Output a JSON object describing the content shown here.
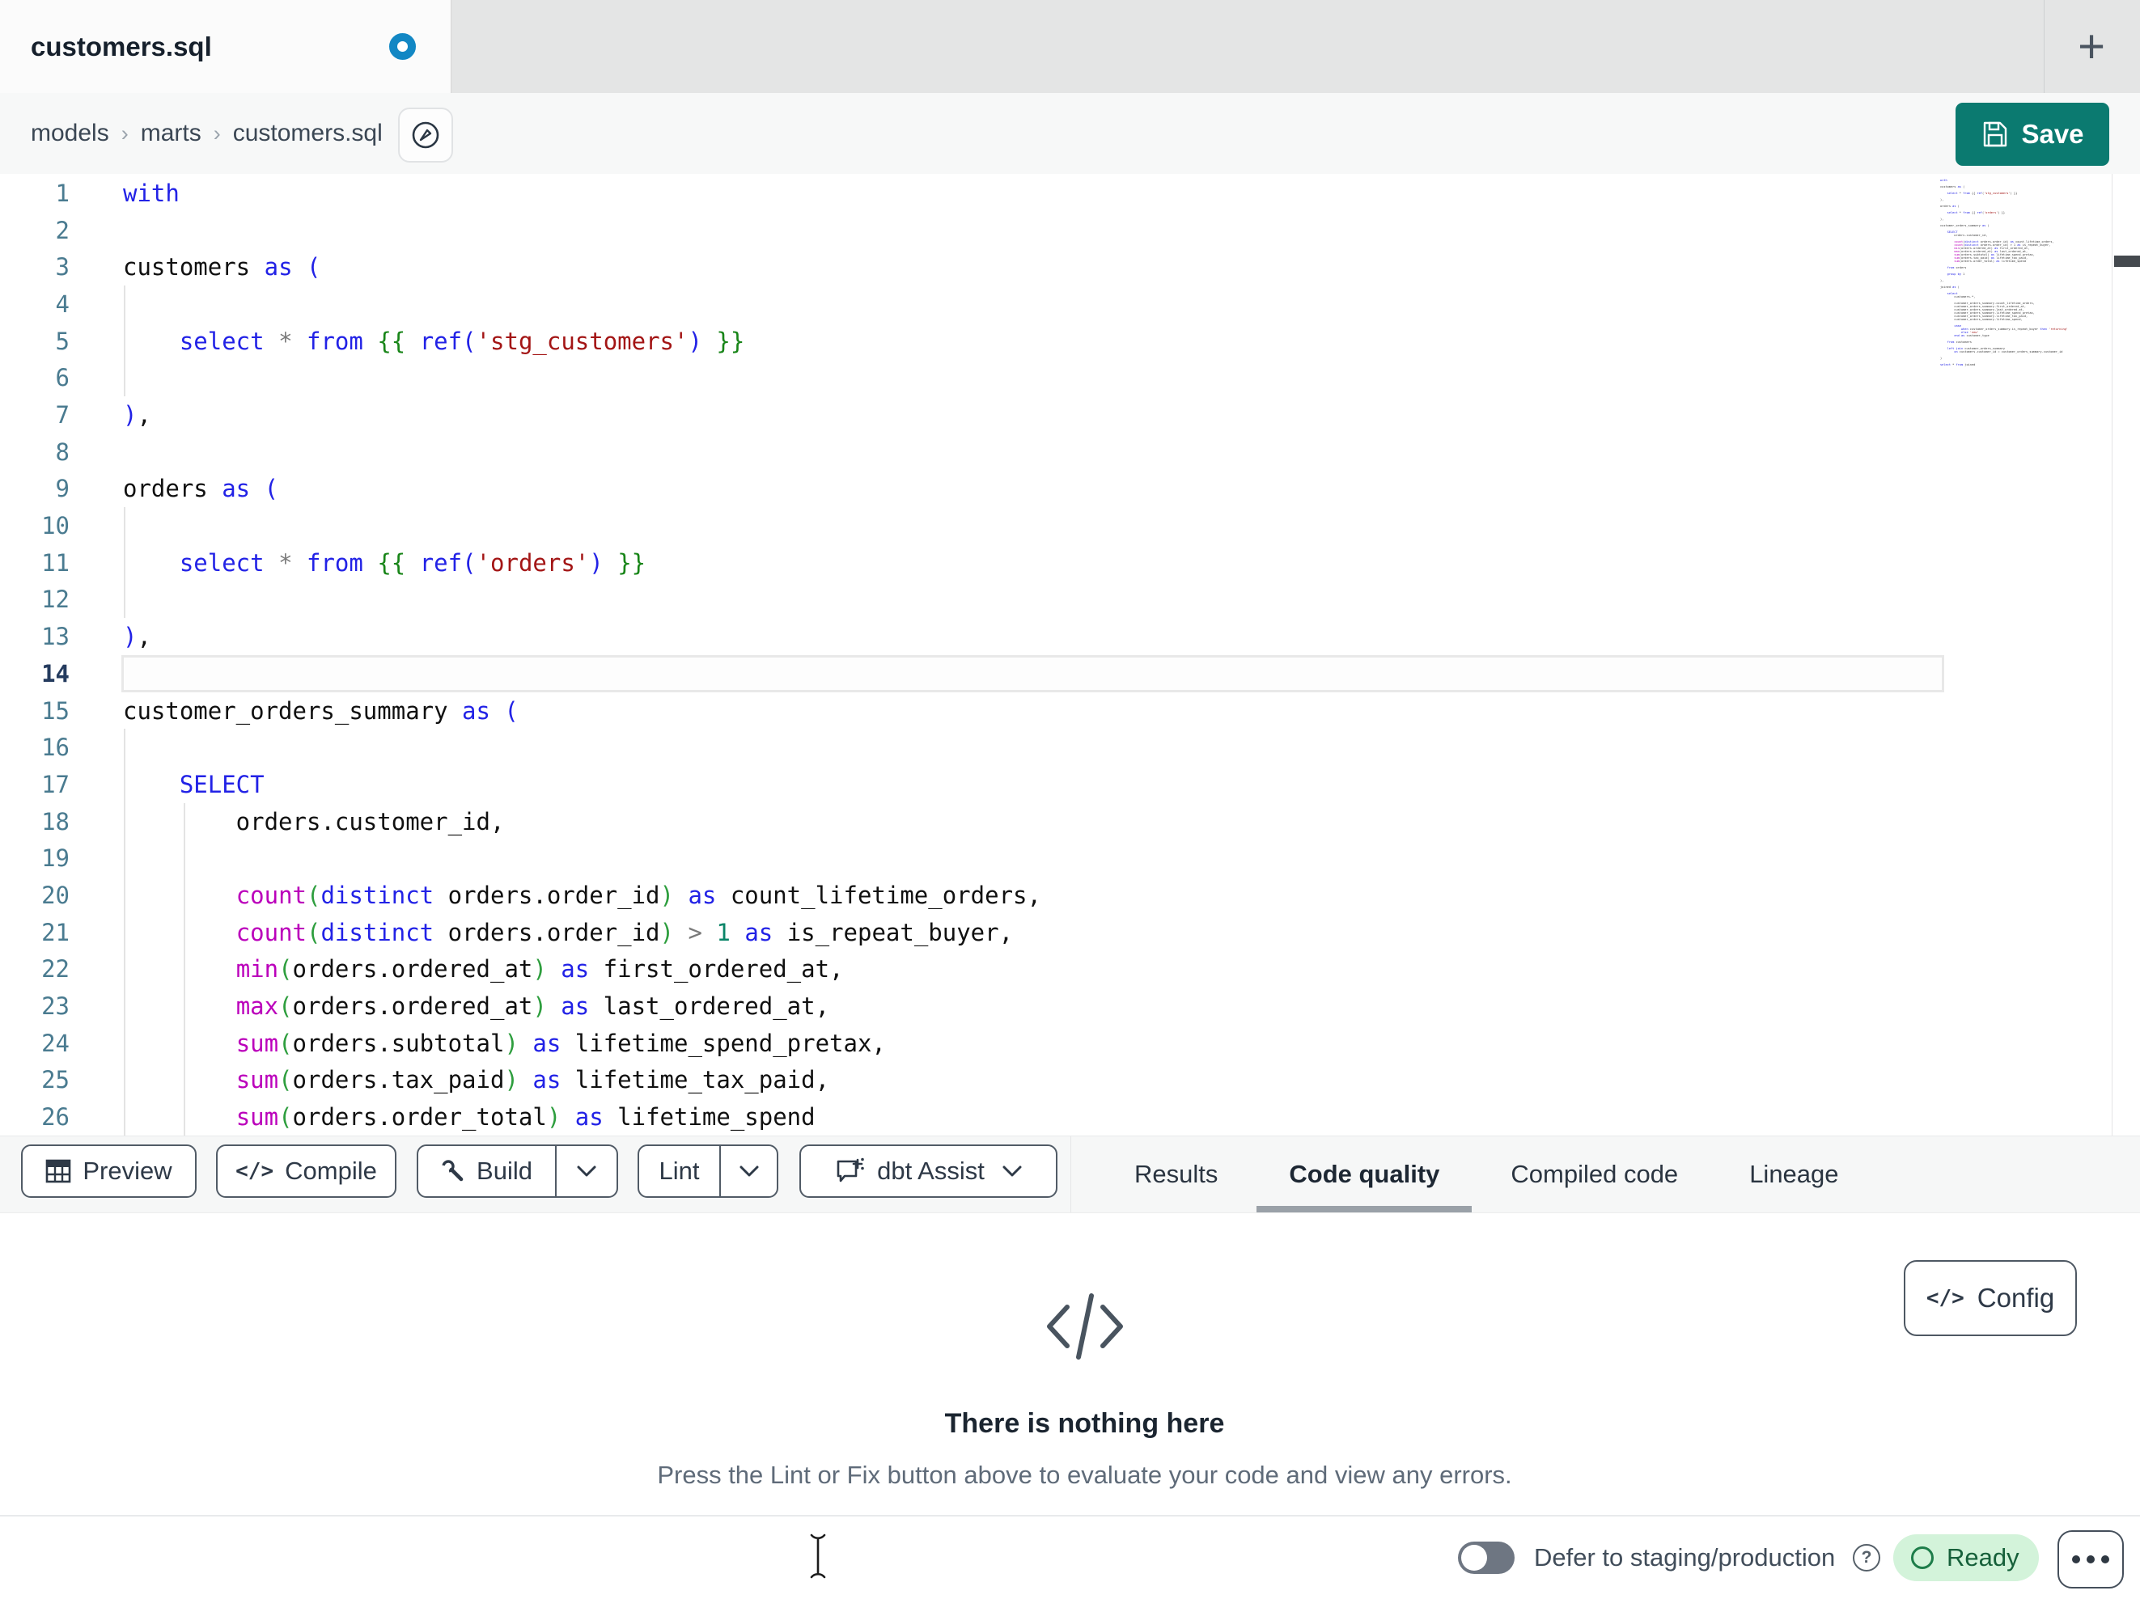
{
  "colors": {
    "accent_teal": "#0B7A70",
    "unsaved_dot_blue": "#1287C4",
    "keyword_blue": "#2222E6",
    "function_magenta": "#BB00BB",
    "string_red": "#A31515",
    "jinja_green": "#188518",
    "number_green": "#0A8568",
    "gutter_teal": "#4A7B90",
    "active_gutter_navy": "#243B5E",
    "ready_bg_green": "#D3F3DA",
    "ready_text_green": "#16603A",
    "tab_underline_gray": "#9AA1A8"
  },
  "tabbar": {
    "title": "customers.sql",
    "new_tab": "+"
  },
  "breadcrumb": {
    "items": [
      "models",
      "marts",
      "customers.sql"
    ],
    "separator": "›"
  },
  "save_label": "Save",
  "editor": {
    "active_line": 14,
    "lines": [
      {
        "tokens": [
          [
            "k",
            "with"
          ]
        ]
      },
      {
        "tokens": []
      },
      {
        "tokens": [
          [
            "v",
            "customers "
          ],
          [
            "k",
            "as"
          ],
          [
            "v",
            " "
          ],
          [
            "bb",
            "("
          ]
        ]
      },
      {
        "tokens": []
      },
      {
        "tokens": [
          [
            "v",
            "    "
          ],
          [
            "k",
            "select"
          ],
          [
            "v",
            " "
          ],
          [
            "o",
            "*"
          ],
          [
            "v",
            " "
          ],
          [
            "k",
            "from"
          ],
          [
            "v",
            " "
          ],
          [
            "j",
            "{{ "
          ],
          [
            "k",
            "ref"
          ],
          [
            "bb",
            "("
          ],
          [
            "s",
            "'stg_customers'"
          ],
          [
            "bb",
            ")"
          ],
          [
            "j",
            " }}"
          ]
        ]
      },
      {
        "tokens": []
      },
      {
        "tokens": [
          [
            "bb",
            ")"
          ],
          [
            "v",
            ","
          ]
        ]
      },
      {
        "tokens": []
      },
      {
        "tokens": [
          [
            "v",
            "orders "
          ],
          [
            "k",
            "as"
          ],
          [
            "v",
            " "
          ],
          [
            "bb",
            "("
          ]
        ]
      },
      {
        "tokens": []
      },
      {
        "tokens": [
          [
            "v",
            "    "
          ],
          [
            "k",
            "select"
          ],
          [
            "v",
            " "
          ],
          [
            "o",
            "*"
          ],
          [
            "v",
            " "
          ],
          [
            "k",
            "from"
          ],
          [
            "v",
            " "
          ],
          [
            "j",
            "{{ "
          ],
          [
            "k",
            "ref"
          ],
          [
            "bb",
            "("
          ],
          [
            "s",
            "'orders'"
          ],
          [
            "bb",
            ")"
          ],
          [
            "j",
            " }}"
          ]
        ]
      },
      {
        "tokens": []
      },
      {
        "tokens": [
          [
            "bb",
            ")"
          ],
          [
            "v",
            ","
          ]
        ]
      },
      {
        "tokens": []
      },
      {
        "tokens": [
          [
            "v",
            "customer_orders_summary "
          ],
          [
            "k",
            "as"
          ],
          [
            "v",
            " "
          ],
          [
            "bb",
            "("
          ]
        ]
      },
      {
        "tokens": []
      },
      {
        "tokens": [
          [
            "v",
            "    "
          ],
          [
            "k",
            "SELECT"
          ]
        ]
      },
      {
        "tokens": [
          [
            "v",
            "        orders.customer_id,"
          ]
        ]
      },
      {
        "tokens": []
      },
      {
        "tokens": [
          [
            "v",
            "        "
          ],
          [
            "f",
            "count"
          ],
          [
            "bg",
            "("
          ],
          [
            "k",
            "distinct"
          ],
          [
            "v",
            " orders.order_id"
          ],
          [
            "bg",
            ")"
          ],
          [
            "v",
            " "
          ],
          [
            "k",
            "as"
          ],
          [
            "v",
            " count_lifetime_orders,"
          ]
        ]
      },
      {
        "tokens": [
          [
            "v",
            "        "
          ],
          [
            "f",
            "count"
          ],
          [
            "bg",
            "("
          ],
          [
            "k",
            "distinct"
          ],
          [
            "v",
            " orders.order_id"
          ],
          [
            "bg",
            ")"
          ],
          [
            "v",
            " "
          ],
          [
            "o",
            ">"
          ],
          [
            "v",
            " "
          ],
          [
            "n",
            "1"
          ],
          [
            "v",
            " "
          ],
          [
            "k",
            "as"
          ],
          [
            "v",
            " is_repeat_buyer,"
          ]
        ]
      },
      {
        "tokens": [
          [
            "v",
            "        "
          ],
          [
            "f",
            "min"
          ],
          [
            "bg",
            "("
          ],
          [
            "v",
            "orders.ordered_at"
          ],
          [
            "bg",
            ")"
          ],
          [
            "v",
            " "
          ],
          [
            "k",
            "as"
          ],
          [
            "v",
            " first_ordered_at,"
          ]
        ]
      },
      {
        "tokens": [
          [
            "v",
            "        "
          ],
          [
            "f",
            "max"
          ],
          [
            "bg",
            "("
          ],
          [
            "v",
            "orders.ordered_at"
          ],
          [
            "bg",
            ")"
          ],
          [
            "v",
            " "
          ],
          [
            "k",
            "as"
          ],
          [
            "v",
            " last_ordered_at,"
          ]
        ]
      },
      {
        "tokens": [
          [
            "v",
            "        "
          ],
          [
            "f",
            "sum"
          ],
          [
            "bg",
            "("
          ],
          [
            "v",
            "orders.subtotal"
          ],
          [
            "bg",
            ")"
          ],
          [
            "v",
            " "
          ],
          [
            "k",
            "as"
          ],
          [
            "v",
            " lifetime_spend_pretax,"
          ]
        ]
      },
      {
        "tokens": [
          [
            "v",
            "        "
          ],
          [
            "f",
            "sum"
          ],
          [
            "bg",
            "("
          ],
          [
            "v",
            "orders.tax_paid"
          ],
          [
            "bg",
            ")"
          ],
          [
            "v",
            " "
          ],
          [
            "k",
            "as"
          ],
          [
            "v",
            " lifetime_tax_paid,"
          ]
        ]
      },
      {
        "tokens": [
          [
            "v",
            "        "
          ],
          [
            "f",
            "sum"
          ],
          [
            "bg",
            "("
          ],
          [
            "v",
            "orders.order_total"
          ],
          [
            "bg",
            ")"
          ],
          [
            "v",
            " "
          ],
          [
            "k",
            "as"
          ],
          [
            "v",
            " lifetime_spend"
          ]
        ]
      }
    ],
    "minimap_text": "with\n\ncustomers as (\n\n    select * from {{ ref('stg_customers') }}\n\n),\n\norders as (\n\n    select * from {{ ref('orders') }}\n\n),\n\ncustomer_orders_summary as (\n\n    SELECT\n        orders.customer_id,\n\n        count(distinct orders.order_id) as count_lifetime_orders,\n        count(distinct orders.order_id) > 1 as is_repeat_buyer,\n        min(orders.ordered_at) as first_ordered_at,\n        max(orders.ordered_at) as last_ordered_at,\n        sum(orders.subtotal) as lifetime_spend_pretax,\n        sum(orders.tax_paid) as lifetime_tax_paid,\n        sum(orders.order_total) as lifetime_spend\n\n    from orders\n\n    group by 1\n\n),\n\njoined as (\n\n    select\n        customers.*,\n\n        customer_orders_summary.count_lifetime_orders,\n        customer_orders_summary.first_ordered_at,\n        customer_orders_summary.last_ordered_at,\n        customer_orders_summary.lifetime_spend_pretax,\n        customer_orders_summary.lifetime_tax_paid,\n        customer_orders_summary.lifetime_spend,\n\n        case\n            when customer_orders_summary.is_repeat_buyer then 'returning'\n            else 'new'\n        end as customer_type\n\n    from customers\n\n    left join customer_orders_summary\n        on customers.customer_id = customer_orders_summary.customer_id\n\n)\n\nselect * from joined"
  },
  "actions": {
    "preview": "Preview",
    "compile": "Compile",
    "build": "Build",
    "lint": "Lint",
    "assist": "dbt Assist",
    "code_glyph": "</>"
  },
  "output_tabs": [
    {
      "label": "Results",
      "active": false
    },
    {
      "label": "Code quality",
      "active": true
    },
    {
      "label": "Compiled code",
      "active": false
    },
    {
      "label": "Lineage",
      "active": false
    }
  ],
  "panel": {
    "config": "Config",
    "empty_title": "There is nothing here",
    "empty_subtitle": "Press the Lint or Fix button above to evaluate your code and view any errors."
  },
  "statusbar": {
    "defer": "Defer to staging/production",
    "ready": "Ready"
  }
}
